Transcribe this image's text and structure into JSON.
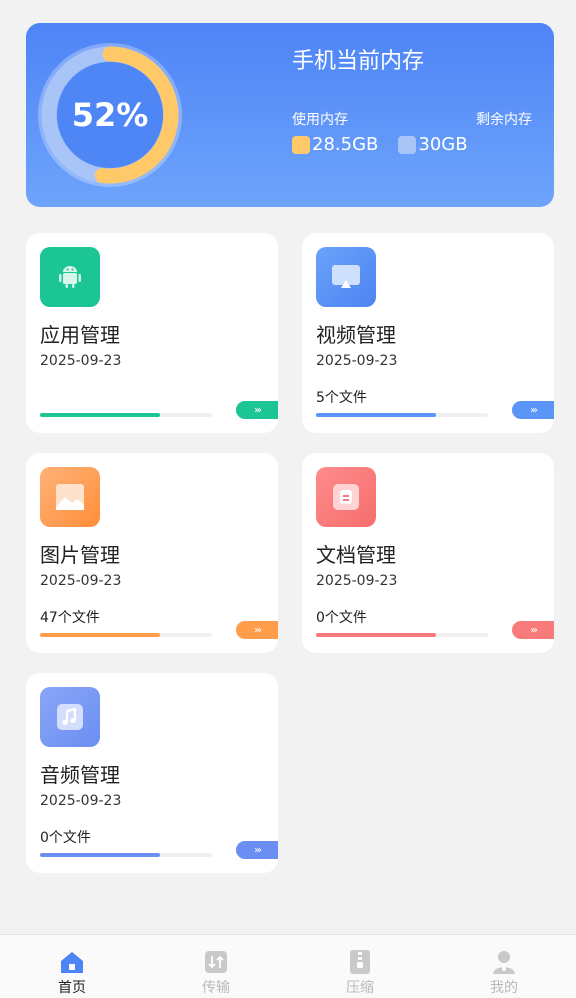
{
  "storage": {
    "percent_label": "52%",
    "used_fraction": 0.52,
    "title": "手机当前内存",
    "used_label": "使用内存",
    "free_label": "剩余内存",
    "used_value": "28.5GB",
    "free_value": "30GB",
    "colors": {
      "used": "#ffc96a",
      "free": "#a9c4f7"
    }
  },
  "categories": [
    {
      "title": "应用管理",
      "date": "2025-09-23",
      "count": "",
      "progress": 0.7,
      "color": "#1bc594",
      "icon": "android-icon"
    },
    {
      "title": "视频管理",
      "date": "2025-09-23",
      "count": "5个文件",
      "progress": 0.7,
      "color": "#5b95f7",
      "icon": "video-icon"
    },
    {
      "title": "图片管理",
      "date": "2025-09-23",
      "count": "47个文件",
      "progress": 0.7,
      "color": "#ff9d4a",
      "icon": "image-icon"
    },
    {
      "title": "文档管理",
      "date": "2025-09-23",
      "count": "0个文件",
      "progress": 0.7,
      "color": "#f97a7a",
      "icon": "document-icon"
    },
    {
      "title": "音频管理",
      "date": "2025-09-23",
      "count": "0个文件",
      "progress": 0.7,
      "color": "#6b8ef2",
      "icon": "music-icon"
    }
  ],
  "arrow_glyph": "›››",
  "nav": {
    "items": [
      {
        "label": "首页",
        "icon": "home-icon",
        "active": true
      },
      {
        "label": "传输",
        "icon": "transfer-icon",
        "active": false
      },
      {
        "label": "压缩",
        "icon": "compress-icon",
        "active": false
      },
      {
        "label": "我的",
        "icon": "profile-icon",
        "active": false
      }
    ]
  }
}
